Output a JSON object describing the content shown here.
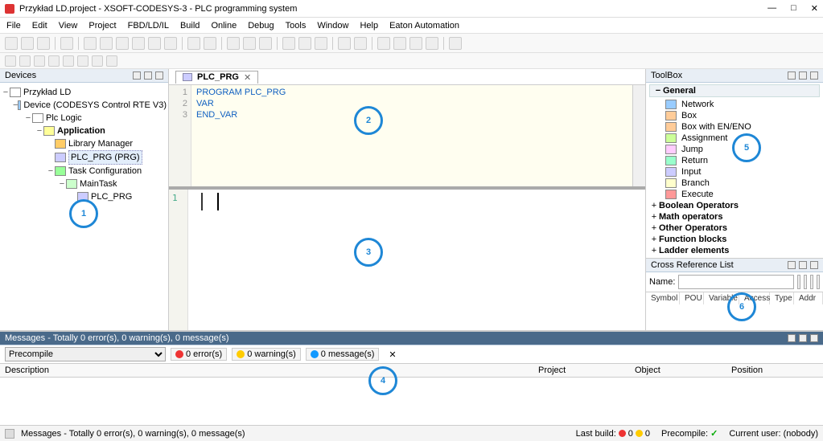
{
  "window": {
    "title": "Przykład LD.project - XSOFT-CODESYS-3 - PLC programming system",
    "buttons": {
      "min": "—",
      "max": "□",
      "close": "✕"
    }
  },
  "menu": [
    "File",
    "Edit",
    "View",
    "Project",
    "FBD/LD/IL",
    "Build",
    "Online",
    "Debug",
    "Tools",
    "Window",
    "Help",
    "Eaton Automation"
  ],
  "devices": {
    "title": "Devices",
    "root": "Przykład LD",
    "device": "Device (CODESYS Control RTE V3)",
    "plc_logic": "Plc Logic",
    "application": "Application",
    "library": "Library Manager",
    "plc_prg": "PLC_PRG (PRG)",
    "task_cfg": "Task Configuration",
    "main_task": "MainTask",
    "plc_prg_leaf": "PLC_PRG"
  },
  "editor": {
    "tab_label": "PLC_PRG",
    "code": [
      "PROGRAM PLC_PRG",
      "VAR",
      "END_VAR"
    ],
    "line_numbers": [
      "1",
      "2",
      "3"
    ],
    "ladder_line": "1"
  },
  "toolbox": {
    "title": "ToolBox",
    "general": "General",
    "items": [
      {
        "k": "net",
        "l": "Network"
      },
      {
        "k": "box",
        "l": "Box"
      },
      {
        "k": "box",
        "l": "Box with EN/ENO"
      },
      {
        "k": "asg",
        "l": "Assignment"
      },
      {
        "k": "jmp",
        "l": "Jump"
      },
      {
        "k": "ret",
        "l": "Return"
      },
      {
        "k": "inp",
        "l": "Input"
      },
      {
        "k": "brn",
        "l": "Branch"
      },
      {
        "k": "exe",
        "l": "Execute"
      }
    ],
    "cats": [
      "Boolean Operators",
      "Math operators",
      "Other Operators",
      "Function blocks",
      "Ladder elements"
    ]
  },
  "crossref": {
    "title": "Cross Reference List",
    "name_label": "Name:",
    "cols": [
      "Symbol",
      "POU",
      "Variable",
      "Access",
      "Type",
      "Addr"
    ]
  },
  "messages": {
    "header": "Messages - Totally 0 error(s), 0 warning(s), 0 message(s)",
    "precompile": "Precompile",
    "err": "0 error(s)",
    "wrn": "0 warning(s)",
    "msg": "0 message(s)",
    "cols": [
      "Description",
      "Project",
      "Object",
      "Position"
    ]
  },
  "status": {
    "left": "Messages - Totally 0 error(s), 0 warning(s), 0 message(s)",
    "last_build": "Last build:",
    "build_err": "0",
    "build_wrn": "0",
    "precompile": "Precompile:",
    "user": "Current user: (nobody)"
  },
  "callouts": {
    "c1": "1",
    "c2": "2",
    "c3": "3",
    "c4": "4",
    "c5": "5",
    "c6": "6"
  }
}
